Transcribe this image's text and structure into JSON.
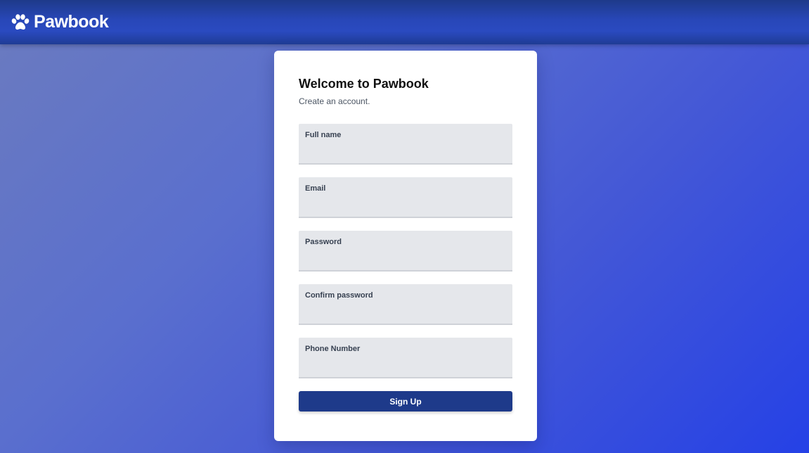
{
  "app": {
    "brand_name": "Pawbook",
    "logo_icon": "paw-icon"
  },
  "signup_form": {
    "title": "Welcome to Pawbook",
    "subtitle": "Create an account.",
    "fields": {
      "full_name": {
        "label": "Full name",
        "value": ""
      },
      "email": {
        "label": "Email",
        "value": ""
      },
      "password": {
        "label": "Password",
        "value": ""
      },
      "confirm_password": {
        "label": "Confirm password",
        "value": ""
      },
      "phone_number": {
        "label": "Phone Number",
        "value": ""
      }
    },
    "submit_label": "Sign Up"
  },
  "colors": {
    "header": "#2847b8",
    "button": "#1e3a8a",
    "field_bg": "#e5e7eb"
  }
}
